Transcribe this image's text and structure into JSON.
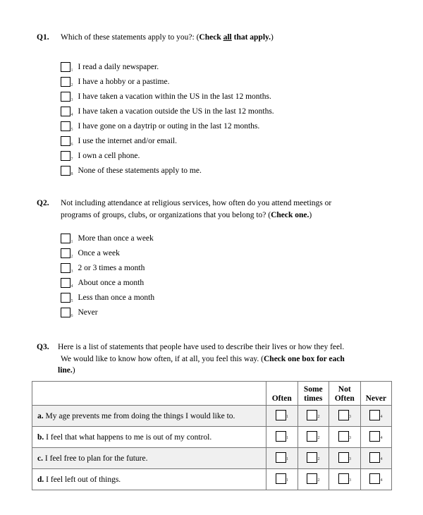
{
  "document": {
    "type": "survey-questionnaire"
  },
  "questions": [
    {
      "label": "Q1.",
      "text_before": "Which of these statements apply to you?:  (",
      "bold_before": "Check ",
      "bold_underline": "all",
      "bold_after": " that apply.",
      "text_after": ")",
      "options": [
        {
          "num": "1",
          "label": "I read a daily newspaper."
        },
        {
          "num": "2",
          "label": "I have a hobby or a pastime."
        },
        {
          "num": "3",
          "label": "I have taken a vacation within the US in the last 12 months."
        },
        {
          "num": "4",
          "label": "I have taken a vacation outside the US in the last 12 months."
        },
        {
          "num": "5",
          "label": "I have gone on a daytrip or outing in the last 12 months."
        },
        {
          "num": "6",
          "label": "I use the internet and/or email."
        },
        {
          "num": "7",
          "label": "I own a cell phone."
        },
        {
          "num": "8",
          "label": "None of these statements apply to me."
        }
      ]
    },
    {
      "label": "Q2.",
      "line1": "Not including attendance at religious services, how often do you attend meetings or",
      "line2_before": "programs of groups, clubs, or organizations that you belong to? (",
      "line2_bold": "Check one.",
      "line2_after": ")",
      "options": [
        {
          "num": "1",
          "label": "More than once a week"
        },
        {
          "num": "2",
          "label": "Once a week"
        },
        {
          "num": "3",
          "label": "2 or 3 times a month"
        },
        {
          "num": "4",
          "label": "About once a month"
        },
        {
          "num": "5",
          "label": "Less than once a month"
        },
        {
          "num": "6",
          "label": "Never"
        }
      ]
    },
    {
      "label": "Q3.",
      "line1": "Here is a list of statements that people have used to describe their lives or how they feel.",
      "line2_before": "We would like to know how often, if at all, you feel this way.  (",
      "line2_bold": "Check one box for each",
      "line3_bold": "line.",
      "line3_after": ")"
    }
  ],
  "table": {
    "headers": [
      "",
      "Often",
      "Some\ntimes",
      "Not\nOften",
      "Never"
    ],
    "header_often": "Often",
    "header_sometimes_l1": "Some",
    "header_sometimes_l2": "times",
    "header_notoften_l1": "Not",
    "header_notoften_l2": "Often",
    "header_never": "Never",
    "rows": [
      {
        "letter": "a.",
        "statement": "My age prevents me from doing the things I would like to.",
        "shaded": true,
        "boxes": [
          "1",
          "2",
          "3",
          "4"
        ]
      },
      {
        "letter": "b.",
        "statement": "I feel that what happens to me is out of my control.",
        "shaded": false,
        "boxes": [
          "1",
          "2",
          "3",
          "4"
        ]
      },
      {
        "letter": "c.",
        "statement": "I feel free to plan for the future.",
        "shaded": true,
        "boxes": [
          "1",
          "2",
          "3",
          "4"
        ]
      },
      {
        "letter": "d.",
        "statement": "I feel left out of things.",
        "shaded": false,
        "boxes": [
          "1",
          "2",
          "3",
          "4"
        ]
      }
    ]
  },
  "colors": {
    "text": "#000000",
    "page_background": "#ffffff",
    "row_shading": "#f0f0f0",
    "grid_line": "#777777",
    "outer_border": "#000000"
  }
}
